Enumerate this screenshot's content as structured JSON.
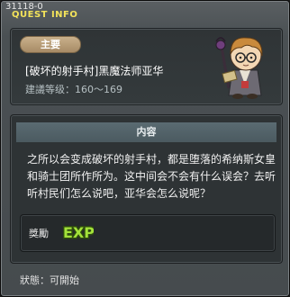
{
  "window": {
    "quest_id": "31118-0",
    "title": "QUEST INFO"
  },
  "header": {
    "badge": "主要",
    "quest_title": "[破坏的射手村]黑魔法师亚华",
    "level_text": "建議等级：160～169",
    "npc_icon": "npc-wizard-portrait"
  },
  "content": {
    "section_title": "内容",
    "description": "之所以会变成破坏的射手村，都是堕落的希纳斯女皇和骑士团所作所为。这中间会不会有什么误会？去听听村民们怎么说吧，亚华会怎么说呢？"
  },
  "reward": {
    "label": "獎勵",
    "exp_icon_text": "EXP"
  },
  "status": {
    "text": "狀態：可開始"
  },
  "colors": {
    "title_yellow": "#f3e35a",
    "exp_green": "#8fd42a"
  }
}
